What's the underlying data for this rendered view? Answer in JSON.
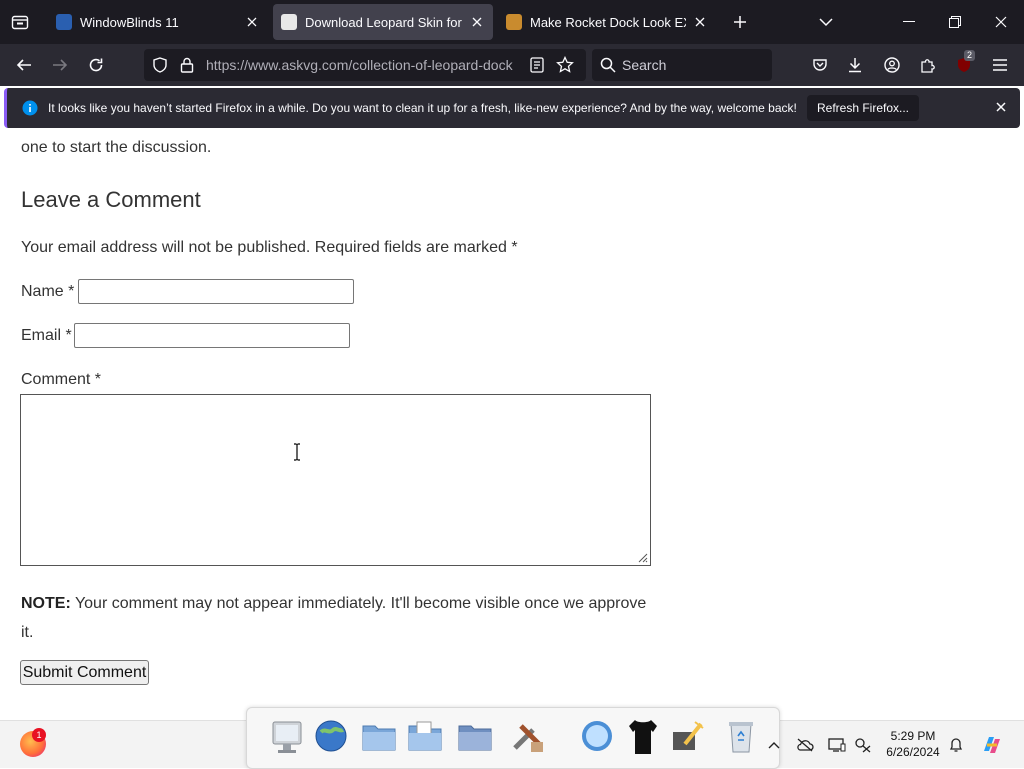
{
  "browser": {
    "tabs": [
      {
        "title": "WindowBlinds 11",
        "active": false
      },
      {
        "title": "Download Leopard Skin for RK",
        "active": true
      },
      {
        "title": "Make Rocket Dock Look EXACT",
        "active": false
      }
    ],
    "url": "https://www.askvg.com/collection-of-leopard-dock",
    "search_placeholder": "Search",
    "extension_badge": "2"
  },
  "notification": {
    "message": "It looks like you haven’t started Firefox in a while. Do you want to clean it up for a fresh, like-new experience? And by the way, welcome back!",
    "button": "Refresh Firefox..."
  },
  "page": {
    "prev_text": "one to start the discussion.",
    "heading": "Leave a Comment",
    "notes": "Your email address will not be published. Required fields are marked *",
    "name_label": "Name *",
    "email_label": "Email *",
    "comment_label": "Comment *",
    "note_bold": "NOTE:",
    "note_text": " Your comment may not appear immediately. It'll become visible once we approve it.",
    "submit_label": "Submit Comment"
  },
  "taskbar": {
    "firefox_badge": "1",
    "time": "5:29 PM",
    "date": "6/26/2024"
  },
  "colors": {
    "tabstrip": "#1c1b22",
    "navbar": "#2b2a33",
    "notice_accent": "#8a5cf5",
    "info_icon": "#0090ed"
  }
}
